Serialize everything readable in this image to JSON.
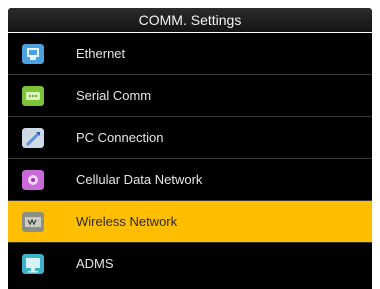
{
  "window": {
    "title": "COMM. Settings"
  },
  "menu": {
    "selected_index": 4,
    "items": [
      {
        "label": "Ethernet",
        "icon": "ethernet-icon",
        "color": "#4aa3e0"
      },
      {
        "label": "Serial Comm",
        "icon": "serial-comm-icon",
        "color": "#7ec23a"
      },
      {
        "label": "PC Connection",
        "icon": "pc-connection-icon",
        "color": "#5b8fd6"
      },
      {
        "label": "Cellular Data Network",
        "icon": "cellular-network-icon",
        "color": "#c96ad8"
      },
      {
        "label": "Wireless Network",
        "icon": "wireless-network-icon",
        "color": "#8c8f86"
      },
      {
        "label": "ADMS",
        "icon": "adms-icon",
        "color": "#3db2c8"
      }
    ]
  },
  "colors": {
    "selected_bg": "#ffbe00",
    "menu_bg": "#000000"
  }
}
